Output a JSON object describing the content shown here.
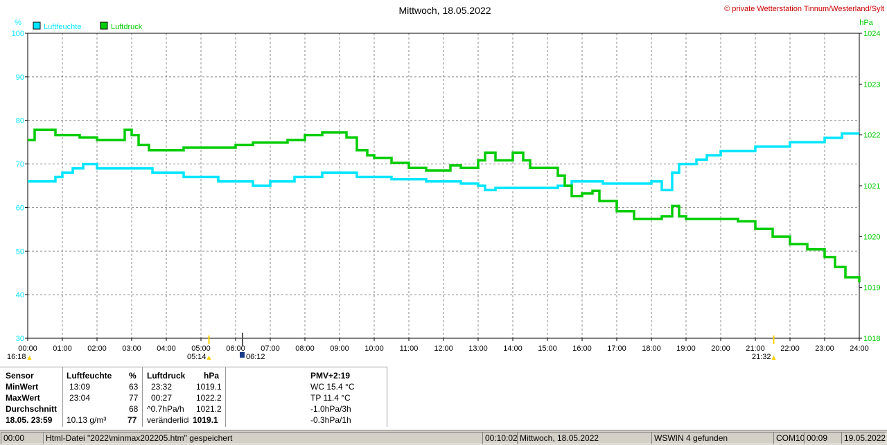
{
  "chart_data": {
    "type": "line",
    "title": "Mittwoch, 18.05.2022",
    "credit": "© private Wetterstation Tinnum/Westerland/Sylt",
    "left_axis": {
      "unit": "%",
      "ylim": [
        30,
        100
      ],
      "ticks": [
        30,
        40,
        50,
        60,
        70,
        80,
        90,
        100
      ],
      "color": "#00e5ff"
    },
    "right_axis": {
      "unit": "hPa",
      "ylim": [
        1018,
        1024
      ],
      "ticks": [
        1018,
        1019,
        1020,
        1021,
        1022,
        1023,
        1024
      ],
      "color": "#00cc00"
    },
    "xlim": [
      0,
      24
    ],
    "x_ticks": [
      "00:00",
      "01:00",
      "02:00",
      "03:00",
      "04:00",
      "05:00",
      "06:00",
      "07:00",
      "08:00",
      "09:00",
      "10:00",
      "11:00",
      "12:00",
      "13:00",
      "14:00",
      "15:00",
      "16:00",
      "17:00",
      "18:00",
      "19:00",
      "20:00",
      "21:00",
      "22:00",
      "23:00",
      "24:00"
    ],
    "grid": true,
    "legend": "top-left",
    "series": [
      {
        "name": "Luftfeuchte",
        "axis": "left",
        "color": "#00e5ff",
        "x": [
          0,
          0.5,
          0.8,
          1.0,
          1.3,
          1.6,
          2.0,
          2.5,
          3.0,
          3.3,
          3.6,
          4.0,
          4.5,
          5.0,
          5.5,
          6.0,
          6.5,
          6.7,
          7.0,
          7.4,
          7.7,
          8.0,
          8.5,
          8.9,
          9.2,
          9.5,
          10.0,
          10.5,
          11.0,
          11.5,
          12.0,
          12.5,
          13.0,
          13.2,
          13.5,
          14.0,
          14.5,
          15.0,
          15.3,
          15.5,
          15.7,
          16.0,
          16.3,
          16.6,
          17.0,
          17.5,
          18.0,
          18.3,
          18.6,
          18.8,
          19.0,
          19.3,
          19.6,
          20.0,
          20.5,
          21.0,
          21.5,
          21.8,
          22.0,
          22.5,
          23.0,
          23.5,
          24.0
        ],
        "y": [
          66,
          66,
          67,
          68,
          69,
          70,
          69,
          69,
          69,
          69,
          68,
          68,
          67,
          67,
          66,
          66,
          65,
          65,
          66,
          66,
          67,
          67,
          68,
          68,
          68,
          67,
          67,
          66.5,
          66.5,
          66,
          66,
          65.5,
          65,
          64,
          64.5,
          64.5,
          64.5,
          64.5,
          65,
          65,
          66,
          66,
          66,
          65.5,
          65.5,
          65.5,
          66,
          64,
          68,
          70,
          70,
          71,
          72,
          73,
          73,
          74,
          74,
          74,
          75,
          75,
          76,
          77,
          77
        ]
      },
      {
        "name": "Luftdruck",
        "axis": "right",
        "color": "#00cc00",
        "x": [
          0,
          0.2,
          0.5,
          0.8,
          1.0,
          1.5,
          2.0,
          2.5,
          2.8,
          3.0,
          3.2,
          3.5,
          3.8,
          4.0,
          4.5,
          5.0,
          5.5,
          6.0,
          6.5,
          7.0,
          7.5,
          8.0,
          8.5,
          9.0,
          9.2,
          9.5,
          9.8,
          10.0,
          10.5,
          11.0,
          11.5,
          12.0,
          12.2,
          12.5,
          13.0,
          13.2,
          13.5,
          14.0,
          14.3,
          14.5,
          15.0,
          15.3,
          15.5,
          15.7,
          16.0,
          16.3,
          16.5,
          17.0,
          17.5,
          18.0,
          18.3,
          18.6,
          18.8,
          19.0,
          19.5,
          20.0,
          20.5,
          21.0,
          21.5,
          22.0,
          22.5,
          23.0,
          23.3,
          23.6,
          24.0
        ],
        "y": [
          1021.9,
          1022.1,
          1022.1,
          1022.0,
          1022.0,
          1021.95,
          1021.9,
          1021.9,
          1022.1,
          1022.0,
          1021.8,
          1021.7,
          1021.7,
          1021.7,
          1021.75,
          1021.75,
          1021.75,
          1021.8,
          1021.85,
          1021.85,
          1021.9,
          1022.0,
          1022.05,
          1022.05,
          1021.95,
          1021.7,
          1021.6,
          1021.55,
          1021.45,
          1021.35,
          1021.3,
          1021.3,
          1021.4,
          1021.35,
          1021.5,
          1021.65,
          1021.5,
          1021.65,
          1021.5,
          1021.35,
          1021.35,
          1021.2,
          1021.0,
          1020.8,
          1020.85,
          1020.9,
          1020.7,
          1020.5,
          1020.35,
          1020.35,
          1020.4,
          1020.6,
          1020.4,
          1020.35,
          1020.35,
          1020.35,
          1020.3,
          1020.15,
          1020.0,
          1019.85,
          1019.75,
          1019.6,
          1019.4,
          1019.2,
          1019.1
        ]
      }
    ],
    "markers": [
      {
        "kind": "moonrise",
        "time": "16:18",
        "x": 0.05
      },
      {
        "kind": "sunrise",
        "time": "05:14",
        "x": 5.23
      },
      {
        "kind": "sunset",
        "time": "21:32",
        "x": 21.53
      },
      {
        "kind": "now",
        "time": "06:12",
        "x": 6.2
      }
    ]
  },
  "legend": {
    "humidity": "Luftfeuchte",
    "pressure": "Luftdruck"
  },
  "table": {
    "headers": {
      "sensor": "Sensor",
      "humidity": "Luftfeuchte",
      "humidity_unit": "%",
      "pressure": "Luftdruck",
      "pressure_unit": "hPa",
      "pmv": "PMV+2:19"
    },
    "rows": [
      {
        "label": "MinWert",
        "h_time": "13:09",
        "h_val": "63",
        "p_time": "23:32",
        "p_val": "1019.1",
        "extra": "WC 15.4 °C"
      },
      {
        "label": "MaxWert",
        "h_time": "23:04",
        "h_val": "77",
        "p_time": "00:27",
        "p_val": "1022.2",
        "extra": "TP 11.4 °C"
      },
      {
        "label": "Durchschnitt",
        "h_time": "",
        "h_val": "68",
        "p_time": "^0.7hPa/h",
        "p_val": "1021.2",
        "extra": "-1.0hPa/3h"
      },
      {
        "label": "18.05.  23:59",
        "h_time": "10.13 g/m³",
        "h_val": "77",
        "p_time": "veränderlich",
        "p_val": "1019.1",
        "extra": "-0.3hPa/1h"
      }
    ]
  },
  "statusbar": {
    "time": "00:00",
    "file": "Html-Datei  \"2022\\minmax202205.htm\"  gespeichert",
    "duration": "00:10:02",
    "date_long": "Mittwoch, 18.05.2022",
    "device": "WSWIN 4 gefunden",
    "port": "COM10",
    "clock": "00:09",
    "date_short": "19.05.2022"
  }
}
